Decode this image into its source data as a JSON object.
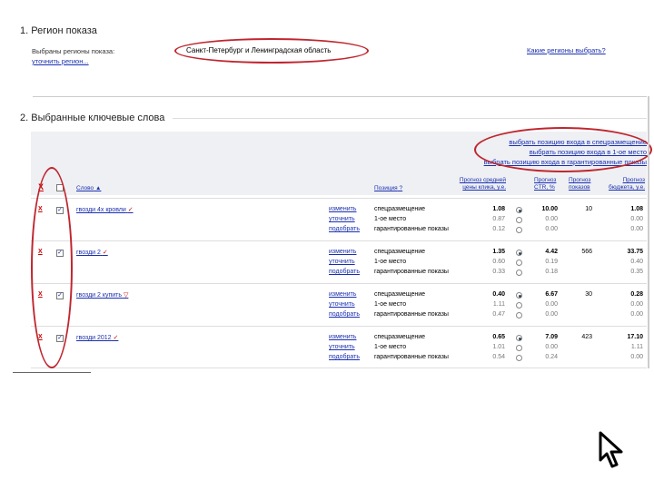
{
  "section1": {
    "title": "1. Регион показа",
    "label": "Выбраны регионы показа:",
    "change_link": "уточнить регион...",
    "value": "Санкт-Петербург и Ленинградская область",
    "how_link": "Какие регионы выбрать?"
  },
  "section2": {
    "title": "2. Выбранные ключевые слова",
    "choose_links": [
      "выбрать позицию входа в спецразмещение",
      "выбрать позицию входа в 1-ое место",
      "выбрать позицию входа в гарантированные показы"
    ],
    "headers": {
      "x": "X",
      "word": "Слово",
      "position": "Позиция",
      "cpc": [
        "Прогноз средней",
        "цены клика, у.е."
      ],
      "ctr": [
        "Прогноз",
        "CTR, %"
      ],
      "shows": [
        "Прогноз",
        "показов"
      ],
      "budget": [
        "Прогноз",
        "бюджета, у.е."
      ]
    },
    "action_labels": [
      "изменить",
      "уточнить",
      "подобрать"
    ],
    "position_labels": [
      "спецразмещение",
      "1-ое место",
      "гарантированные показы"
    ],
    "rows": [
      {
        "x": "X",
        "check": "✓",
        "word": "гвозди 4х кровли",
        "marker": "✓",
        "cpc": [
          "1.08",
          "0.87",
          "0.12"
        ],
        "selected": 0,
        "ctr": [
          "10.00",
          "0.00",
          "0.00"
        ],
        "shows": "10",
        "budget": [
          "1.08",
          "0.00",
          "0.00"
        ]
      },
      {
        "x": "X",
        "check": "✓",
        "word": "гвозди 2",
        "marker": "✓",
        "cpc": [
          "1.35",
          "0.60",
          "0.33"
        ],
        "selected": 0,
        "ctr": [
          "4.42",
          "0.19",
          "0.18"
        ],
        "shows": "566",
        "budget": [
          "33.75",
          "0.40",
          "0.35"
        ]
      },
      {
        "x": "X",
        "check": "✓",
        "word": "гвозди 2 купить",
        "marker": "▽",
        "cpc": [
          "0.40",
          "1.11",
          "0.47"
        ],
        "selected": 0,
        "ctr": [
          "6.67",
          "0.00",
          "0.00"
        ],
        "shows": "30",
        "budget": [
          "0.28",
          "0.00",
          "0.00"
        ]
      },
      {
        "x": "X",
        "check": "✓",
        "word": "гвозди 2012",
        "marker": "✓",
        "cpc": [
          "0.65",
          "1.01",
          "0.54"
        ],
        "selected": 0,
        "ctr": [
          "7.09",
          "0.00",
          "0.24"
        ],
        "shows": "423",
        "budget": [
          "17.10",
          "1.11",
          "0.00"
        ]
      }
    ]
  },
  "colors": {
    "link": "#1a2fb0",
    "annotation": "#c0262f",
    "accent_red": "#cc0000"
  }
}
